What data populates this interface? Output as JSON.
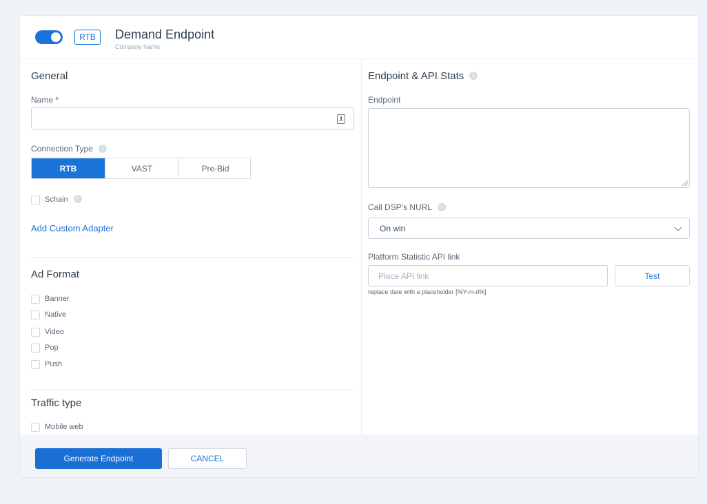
{
  "header": {
    "title": "Demand Endpoint",
    "subtitle": "Company Name",
    "badge": "RTB",
    "toggle_on": true
  },
  "general": {
    "section_title": "General",
    "name_label": "Name *",
    "name_value": "",
    "connection_type_label": "Connection Type",
    "connection_types": [
      "RTB",
      "VAST",
      "Pre-Bid"
    ],
    "connection_selected": "RTB",
    "schain_label": "Schain",
    "add_custom_adapter": "Add Custom Adapter"
  },
  "ad_format": {
    "section_title": "Ad Format",
    "options": [
      "Banner",
      "Native",
      "Video",
      "Pop",
      "Push"
    ]
  },
  "traffic_type": {
    "section_title": "Traffic type",
    "options": [
      "Mobile web"
    ]
  },
  "endpoint_stats": {
    "section_title": "Endpoint & API Stats",
    "endpoint_label": "Endpoint",
    "endpoint_value": "",
    "call_nurl_label": "Call DSP's NURL",
    "call_nurl_value": "On win",
    "api_link_label": "Platform Statistic API link",
    "api_link_placeholder": "Place API link",
    "test_button": "Test",
    "hint": "replace date with a placeholder [%Y-m-d%]"
  },
  "footer": {
    "generate_button": "Generate Endpoint",
    "cancel_button": "CANCEL"
  },
  "colors": {
    "accent": "#1a73d9",
    "background": "#eef3f8"
  }
}
